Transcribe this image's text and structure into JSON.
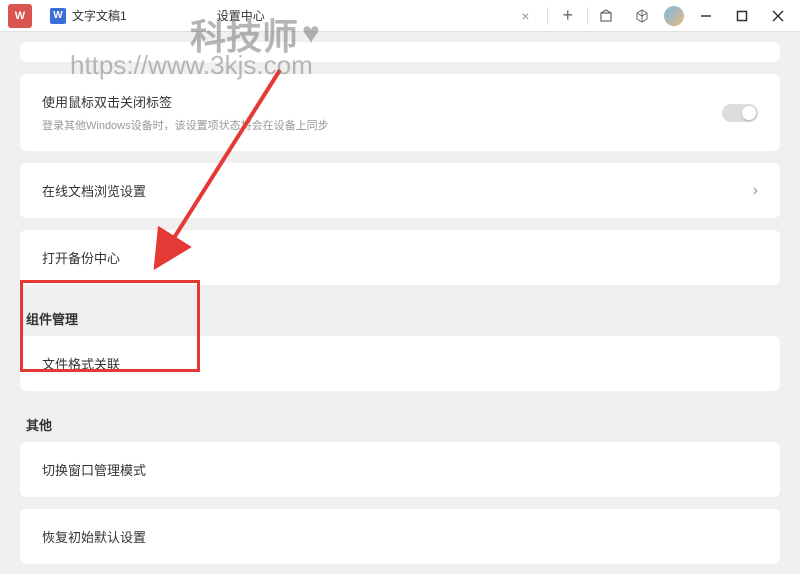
{
  "tabs": {
    "doc_tab": "文字文稿1",
    "settings_tab": "设置中心"
  },
  "watermark": {
    "text": "科技师",
    "url": "https://www.3kjs.com"
  },
  "settings": {
    "doubleclick": {
      "title": "使用鼠标双击关闭标签",
      "subtitle": "登录其他Windows设备时，该设置项状态将会在设备上同步"
    },
    "onlinedoc": {
      "title": "在线文档浏览设置"
    },
    "backup": {
      "title": "打开备份中心"
    }
  },
  "sections": {
    "component": {
      "header": "组件管理",
      "fileassoc": "文件格式关联"
    },
    "other": {
      "header": "其他",
      "windowmode": "切换窗口管理模式",
      "restore": "恢复初始默认设置"
    }
  }
}
